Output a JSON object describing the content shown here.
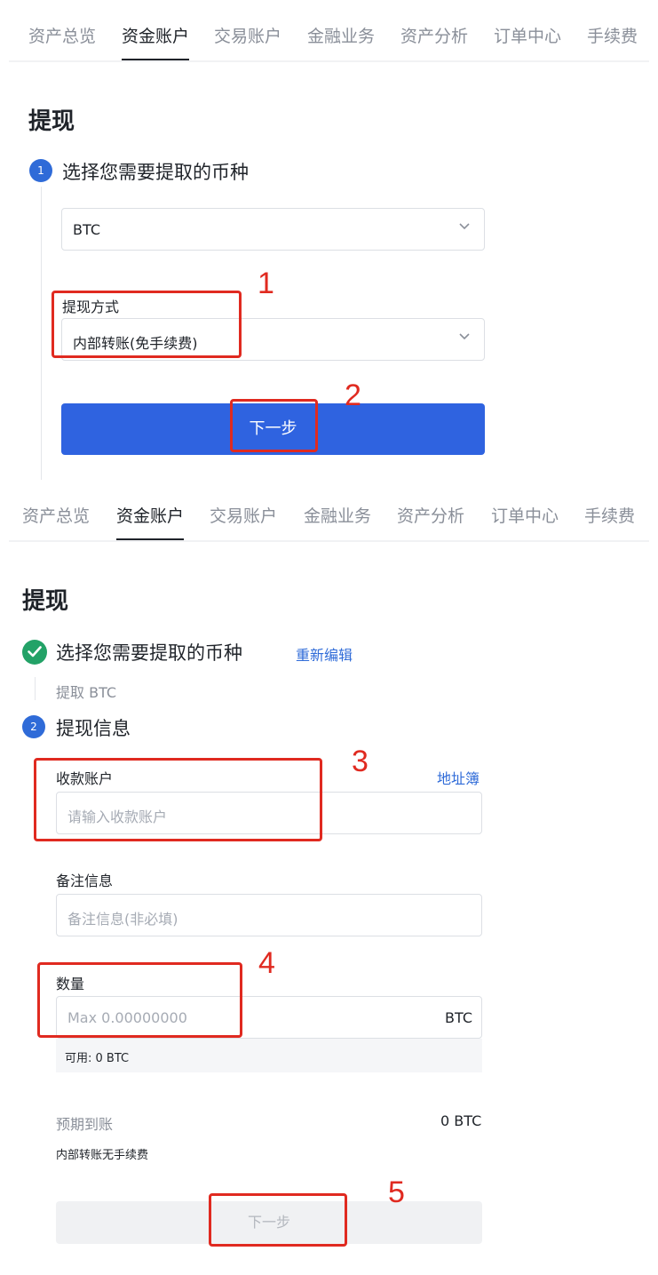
{
  "nav_tabs": [
    "资产总览",
    "资金账户",
    "交易账户",
    "金融业务",
    "资产分析",
    "订单中心",
    "手续费"
  ],
  "nav_active_index": 1,
  "panel1": {
    "title": "提现",
    "step1_number": "1",
    "step1_text": "选择您需要提取的币种",
    "currency_value": "BTC",
    "method_label": "提现方式",
    "method_value": "内部转账(免手续费)",
    "next_button": "下一步"
  },
  "panel2": {
    "title": "提现",
    "step1_text": "选择您需要提取的币种",
    "reedit_link": "重新编辑",
    "step1_summary": "提取 BTC",
    "step2_number": "2",
    "step2_text": "提现信息",
    "receive_label": "收款账户",
    "address_book_link": "地址簿",
    "receive_placeholder": "请输入收款账户",
    "remark_label": "备注信息",
    "remark_placeholder": "备注信息(非必填)",
    "amount_label": "数量",
    "amount_placeholder": "Max 0.00000000",
    "amount_unit": "BTC",
    "available_text": "可用:  0 BTC",
    "expected_label": "预期到账",
    "expected_value": "0 BTC",
    "fee_note": "内部转账无手续费",
    "next_button": "下一步"
  },
  "annotations": [
    "1",
    "2",
    "3",
    "4",
    "5"
  ],
  "colors": {
    "accent": "#2f63e0",
    "success": "#23a267",
    "annotation": "#e02a20"
  }
}
